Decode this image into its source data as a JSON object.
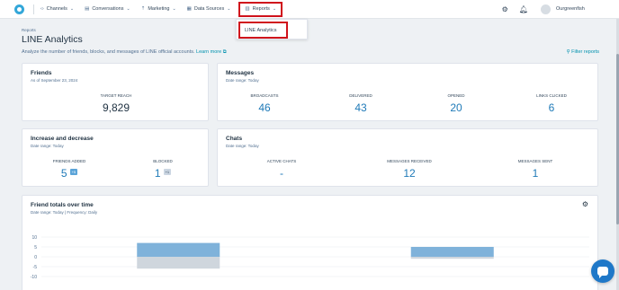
{
  "nav": {
    "items": [
      {
        "icon": "code-icon",
        "glyph": "‹›",
        "label": "Channels"
      },
      {
        "icon": "chat-icon",
        "glyph": "▤",
        "label": "Conversations"
      },
      {
        "icon": "megaphone-icon",
        "glyph": "⇡",
        "label": "Marketing"
      },
      {
        "icon": "database-icon",
        "glyph": "▦",
        "label": "Data Sources"
      },
      {
        "icon": "chart-icon",
        "glyph": "▥",
        "label": "Reports"
      }
    ],
    "user_name": "Ourgreenfish",
    "dropdown_item": "LINE Analytics"
  },
  "page": {
    "breadcrumb": "Reports",
    "title": "LINE Analytics",
    "subtitle": "Analyze the number of friends, blocks, and messages of LINE official accounts.",
    "learn_more": "Learn more",
    "filter_label": "Filter reports"
  },
  "friends": {
    "title": "Friends",
    "as_of": "As of September 23, 2024",
    "target_reach_label": "TARGET REACH",
    "target_reach_value": "9,829"
  },
  "messages": {
    "title": "Messages",
    "date_range": "Date range: Today",
    "metrics": [
      {
        "label": "BROADCASTS",
        "value": "46"
      },
      {
        "label": "DELIVERED",
        "value": "43"
      },
      {
        "label": "OPENED",
        "value": "20"
      },
      {
        "label": "LINKS CLICKED",
        "value": "6"
      }
    ]
  },
  "increase": {
    "title": "Increase and decrease",
    "date_range": "Date range: Today",
    "added_label": "FRIENDS ADDED",
    "added_value": "5",
    "added_badge": "+5",
    "blocked_label": "BLOCKED",
    "blocked_value": "1",
    "blocked_badge": "+1"
  },
  "chats": {
    "title": "Chats",
    "date_range": "Date range: Today",
    "metrics": [
      {
        "label": "ACTIVE CHATS",
        "value": "-"
      },
      {
        "label": "MESSAGES RECEIVED",
        "value": "12"
      },
      {
        "label": "MESSAGES SENT",
        "value": "1"
      }
    ]
  },
  "chart_card": {
    "title": "Friend totals over time",
    "date_range": "Date range: Today | Frequency: Daily"
  },
  "chart_data": {
    "type": "bar",
    "y_ticks": [
      "10",
      "5",
      "0",
      "-5",
      "-10"
    ],
    "ylim": [
      -10,
      10
    ],
    "series": [
      {
        "color": "#7fb2da",
        "values": [
          7,
          5
        ]
      },
      {
        "color": "#cfd6dd",
        "values": [
          -6,
          -1
        ]
      }
    ],
    "colors": {
      "positive": "#7fb2da",
      "negative": "#cfd6dd"
    }
  }
}
